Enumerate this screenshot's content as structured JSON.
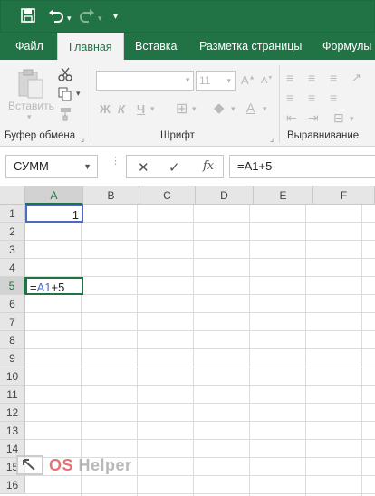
{
  "quick_access": {
    "save_icon": "save-icon",
    "undo_icon": "undo-icon",
    "redo_icon": "redo-icon",
    "customize_icon": "customize-icon"
  },
  "tabs": [
    {
      "label": "Файл"
    },
    {
      "label": "Главная",
      "active": true
    },
    {
      "label": "Вставка"
    },
    {
      "label": "Разметка страницы"
    },
    {
      "label": "Формулы"
    }
  ],
  "ribbon": {
    "clipboard": {
      "paste_label": "Вставить",
      "group_label": "Буфер обмена"
    },
    "font": {
      "font_size": "11",
      "bold": "Ж",
      "italic": "К",
      "underline": "Ч",
      "group_label": "Шрифт"
    },
    "alignment": {
      "group_label": "Выравнивание"
    }
  },
  "formula_bar": {
    "name_box": "СУММ",
    "fx_label": "fx",
    "formula": "=A1+5"
  },
  "sheet": {
    "columns": [
      "A",
      "B",
      "C",
      "D",
      "E",
      "F"
    ],
    "rows": [
      "1",
      "2",
      "3",
      "4",
      "5",
      "6",
      "7",
      "8",
      "9",
      "10",
      "11",
      "12",
      "13",
      "14",
      "15",
      "16"
    ],
    "cells": {
      "A1": "1",
      "A5_ref": "A1",
      "A5_eq": "=",
      "A5_rest": "+5"
    }
  },
  "watermark": {
    "brand_os": "OS",
    "brand_helper": "Helper"
  }
}
